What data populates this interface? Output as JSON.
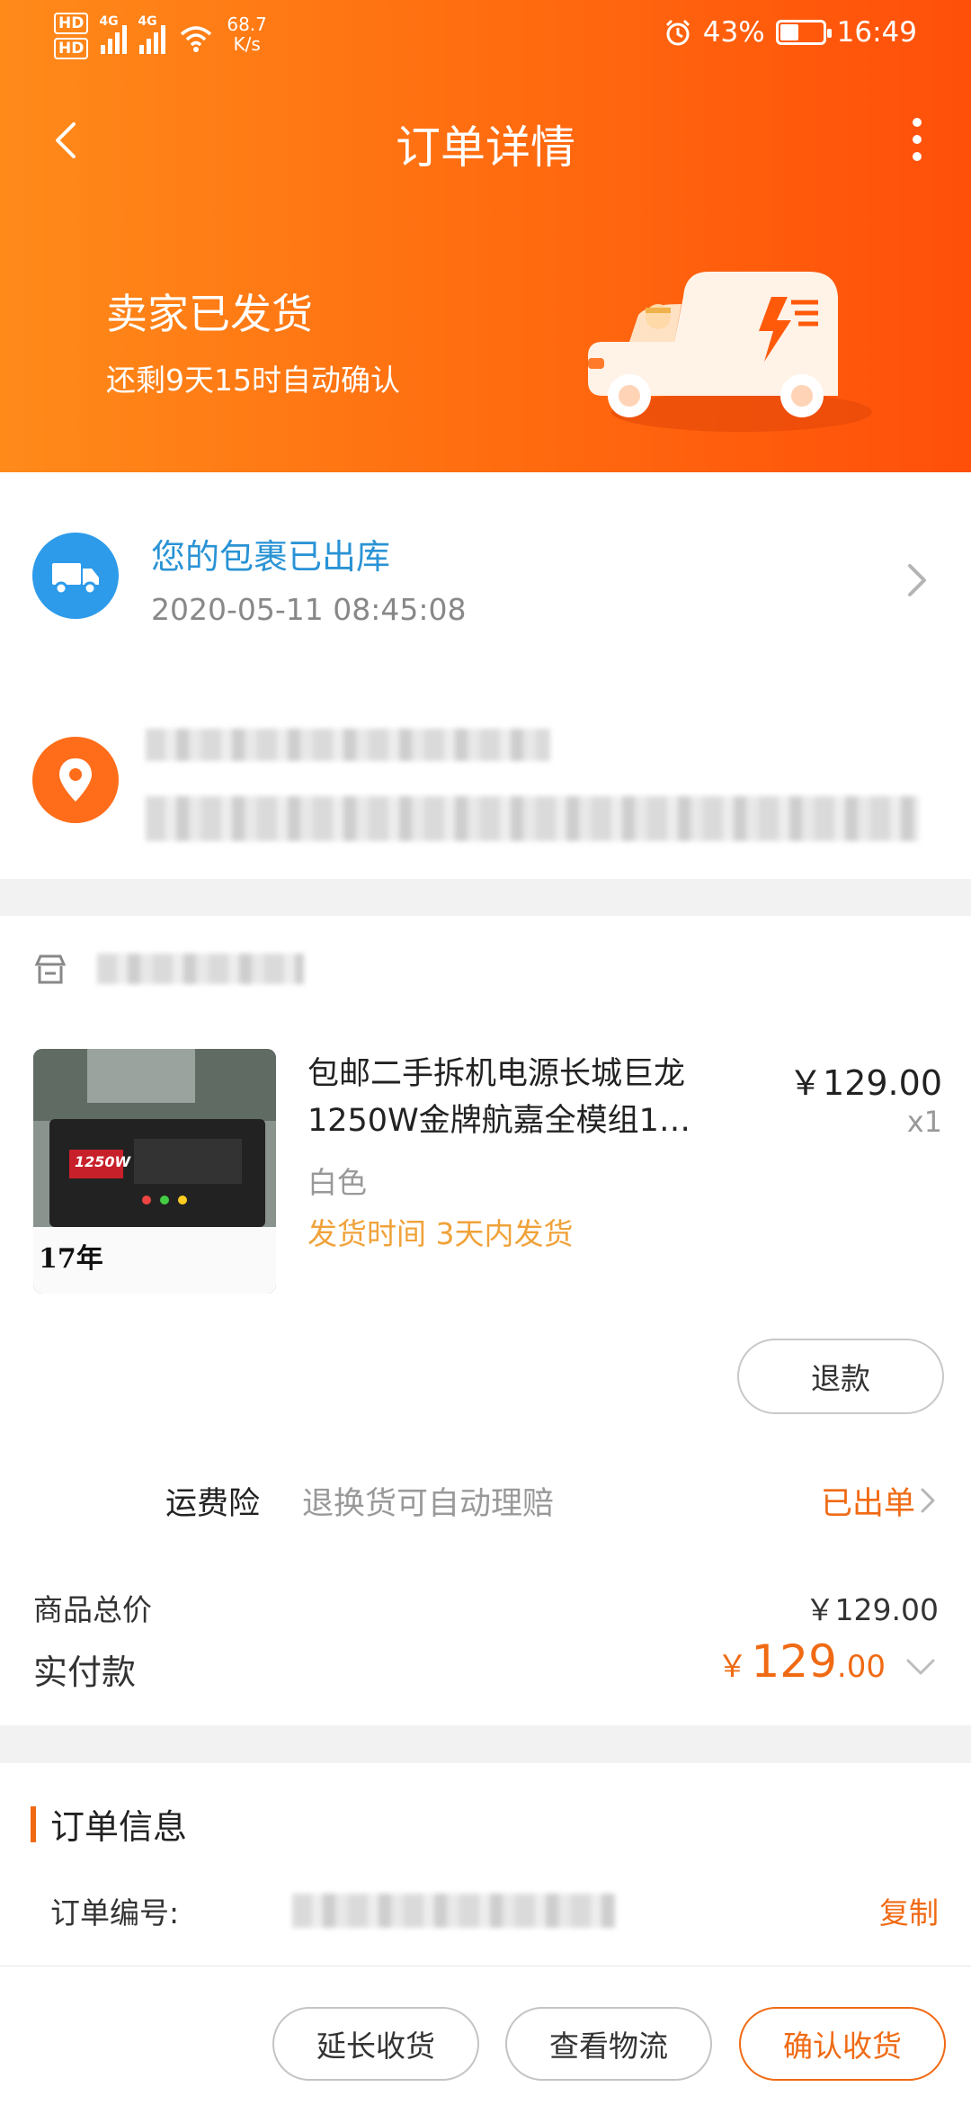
{
  "status_bar": {
    "network_tag_1": "HD",
    "network_tag_2": "HD",
    "signal_1_tag": "4G",
    "signal_2_tag": "4G",
    "speed_value": "68.7",
    "speed_unit": "K/s",
    "battery": "43%",
    "battery_level": 0.43,
    "time": "16:49"
  },
  "nav": {
    "title": "订单详情"
  },
  "shipping": {
    "title": "卖家已发货",
    "subtitle": "还剩9天15时自动确认"
  },
  "logistics": {
    "title": "您的包裹已出库",
    "time": "2020-05-11 08:45:08"
  },
  "product": {
    "name": "包邮二手拆机电源长城巨龙1250W金牌航嘉全模组1…",
    "price": "￥129.00",
    "quantity": "x1",
    "variant": "白色",
    "ship_time": "发货时间 3天内发货",
    "image_caption": "17年",
    "image_screen_text": "1250W"
  },
  "actions": {
    "refund": "退款"
  },
  "insurance": {
    "label": "运费险",
    "description": "退换货可自动理赔",
    "status": "已出单"
  },
  "totals": {
    "goods_total_label": "商品总价",
    "goods_total_value": "￥129.00",
    "paid_label": "实付款",
    "paid_currency": "￥",
    "paid_integer": "129",
    "paid_decimal": ".00"
  },
  "order_info": {
    "title": "订单信息",
    "order_no_label": "订单编号:",
    "copy": "复制"
  },
  "bottom_bar": {
    "extend": "延长收货",
    "logistics": "查看物流",
    "confirm": "确认收货"
  },
  "colors": {
    "header_start": "#ff8a1a",
    "header_end": "#ff4f0a",
    "accent": "#f06a14",
    "logistics_blue": "#2d9bea",
    "ship_time_yellow": "#f0a23a"
  }
}
